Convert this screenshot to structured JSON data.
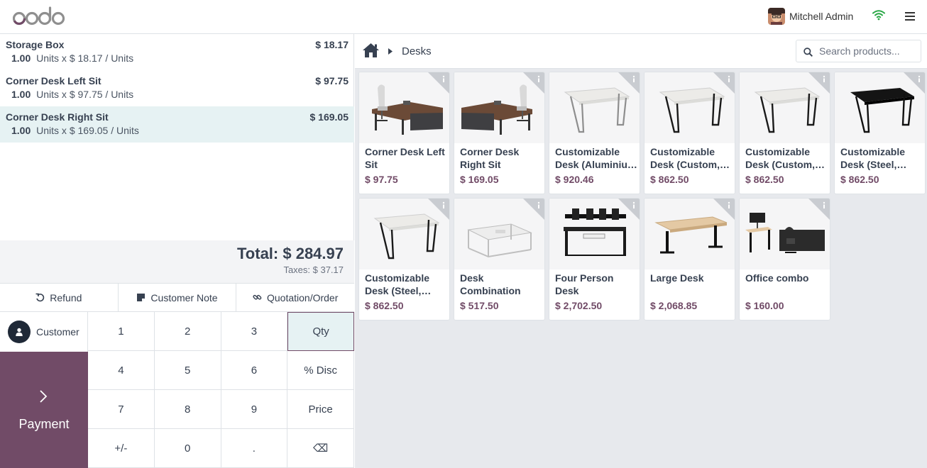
{
  "header": {
    "logo_text": "odoo",
    "user_name": "Mitchell Admin"
  },
  "order": {
    "lines": [
      {
        "name": "Storage Box",
        "price": "$ 18.17",
        "qty": "1.00",
        "detail": "Units x $ 18.17 / Units",
        "selected": false
      },
      {
        "name": "Corner Desk Left Sit",
        "price": "$ 97.75",
        "qty": "1.00",
        "detail": "Units x $ 97.75 / Units",
        "selected": false
      },
      {
        "name": "Corner Desk Right Sit",
        "price": "$ 169.05",
        "qty": "1.00",
        "detail": "Units x $ 169.05 / Units",
        "selected": true
      }
    ],
    "total": "Total: $ 284.97",
    "taxes": "Taxes: $ 37.17"
  },
  "controls": {
    "refund": "Refund",
    "customer_note": "Customer Note",
    "quotation": "Quotation/Order"
  },
  "customer_label": "Customer",
  "payment_label": "Payment",
  "numpad": [
    "1",
    "2",
    "3",
    "Qty",
    "4",
    "5",
    "6",
    "% Disc",
    "7",
    "8",
    "9",
    "Price",
    "+/-",
    "0",
    ".",
    "⌫"
  ],
  "numpad_active": "Qty",
  "breadcrumb": {
    "category": "Desks"
  },
  "search": {
    "placeholder": "Search products..."
  },
  "colors": {
    "brand": "#714b67",
    "selected_bg": "#e6f2f3"
  },
  "products": [
    {
      "name": "Corner Desk Left Sit",
      "price": "$ 97.75",
      "image": "corner-desk-left"
    },
    {
      "name": "Corner Desk Right Sit",
      "price": "$ 169.05",
      "image": "corner-desk-right"
    },
    {
      "name": "Customizable Desk (Aluminiu…",
      "price": "$ 920.46",
      "image": "white-table-silver"
    },
    {
      "name": "Customizable Desk (Custom,…",
      "price": "$ 862.50",
      "image": "white-table-black"
    },
    {
      "name": "Customizable Desk (Custom,…",
      "price": "$ 862.50",
      "image": "white-table-black"
    },
    {
      "name": "Customizable Desk (Steel,…",
      "price": "$ 862.50",
      "image": "black-table"
    },
    {
      "name": "Customizable Desk (Steel,…",
      "price": "$ 862.50",
      "image": "white-table-black"
    },
    {
      "name": "Desk Combination",
      "price": "$ 517.50",
      "image": "desk-combination"
    },
    {
      "name": "Four Person Desk",
      "price": "$ 2,702.50",
      "image": "four-person-desk"
    },
    {
      "name": "Large Desk",
      "price": "$ 2,068.85",
      "image": "large-desk"
    },
    {
      "name": "Office combo",
      "price": "$ 160.00",
      "image": "office-combo"
    }
  ]
}
